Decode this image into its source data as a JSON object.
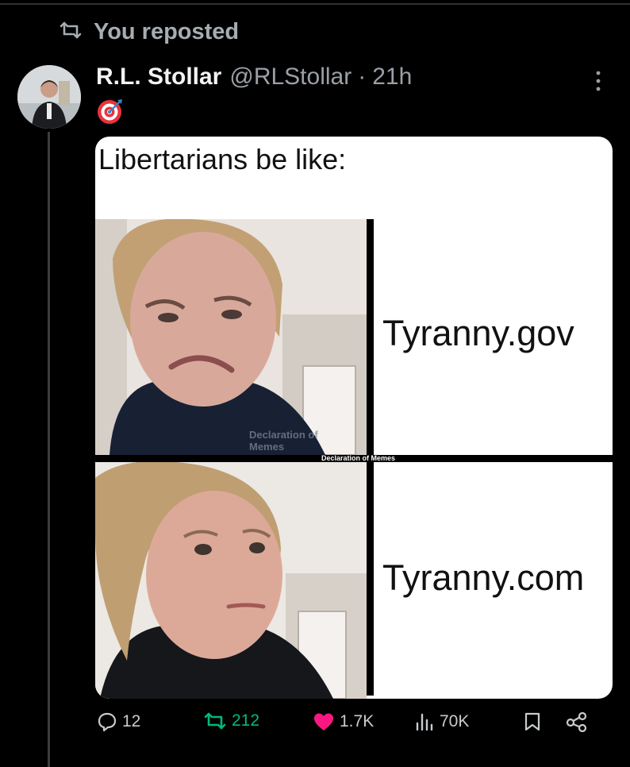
{
  "repost": {
    "label": "You reposted"
  },
  "author": {
    "name": "R.L. Stollar",
    "handle": "@RLStollar",
    "separator": "·",
    "time": "21h"
  },
  "post": {
    "caption": "Libertarians be like:",
    "panels": [
      {
        "text": "Tyranny.gov"
      },
      {
        "text": "Tyranny.com"
      }
    ],
    "watermark_face": "Declaration of Memes",
    "watermark_divider": "Declaration of Memes"
  },
  "actions": {
    "replies": "12",
    "reposts": "212",
    "likes": "1.7K",
    "views": "70K"
  },
  "colors": {
    "repost_green": "#00ba7c",
    "like_pink": "#f91880",
    "text_secondary": "#9aa0a6"
  }
}
